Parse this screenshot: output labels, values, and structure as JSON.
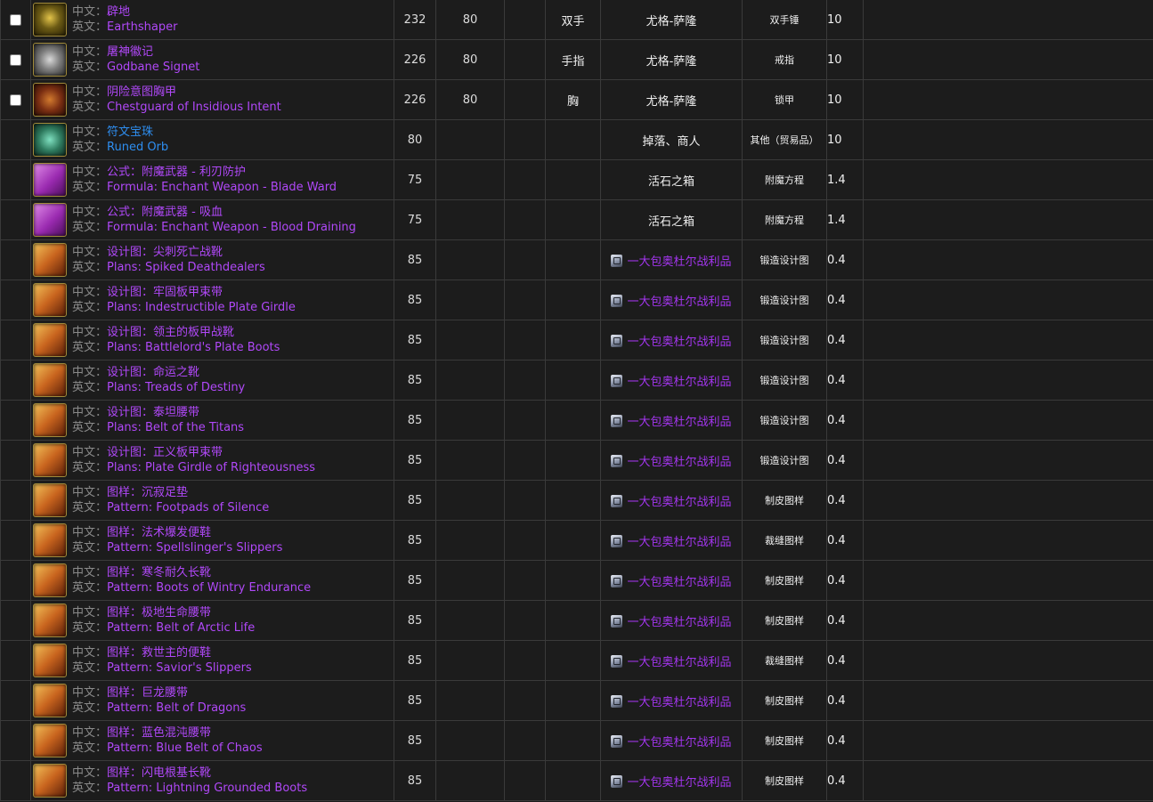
{
  "labels": {
    "cn": "中文：",
    "en": "英文："
  },
  "rows": [
    {
      "checkbox": true,
      "icon": "earthshaper-mace-icon",
      "icon_class": "icon-earthshaper",
      "cn": "辟地",
      "en": "Earthshaper",
      "color": "purple",
      "ilvl": "232",
      "req": "80",
      "slot": "双手",
      "source": "尤格-萨隆",
      "source_link": false,
      "category": "双手锤",
      "drop": "10"
    },
    {
      "checkbox": true,
      "icon": "ring-icon",
      "icon_class": "icon-ring",
      "cn": "屠神徽记",
      "en": "Godbane Signet",
      "color": "purple",
      "ilvl": "226",
      "req": "80",
      "slot": "手指",
      "source": "尤格-萨隆",
      "source_link": false,
      "category": "戒指",
      "drop": "10"
    },
    {
      "checkbox": true,
      "icon": "chestguard-icon",
      "icon_class": "icon-chest",
      "cn": "阴险意图胸甲",
      "en": "Chestguard of Insidious Intent",
      "color": "purple",
      "ilvl": "226",
      "req": "80",
      "slot": "胸",
      "source": "尤格-萨隆",
      "source_link": false,
      "category": "锁甲",
      "drop": "10"
    },
    {
      "checkbox": false,
      "icon": "runed-orb-icon",
      "icon_class": "icon-orb",
      "cn": "符文宝珠",
      "en": "Runed Orb",
      "color": "blue",
      "ilvl": "80",
      "req": "",
      "slot": "",
      "source": "掉落、商人",
      "source_link": false,
      "category": "其他（贸易品）",
      "drop": "10"
    },
    {
      "checkbox": false,
      "icon": "formula-icon",
      "icon_class": "icon-formula",
      "cn": "公式：附魔武器 - 利刃防护",
      "en": "Formula: Enchant Weapon - Blade Ward",
      "color": "purple",
      "ilvl": "75",
      "req": "",
      "slot": "",
      "source": "活石之箱",
      "source_link": false,
      "category": "附魔方程",
      "drop": "1.4"
    },
    {
      "checkbox": false,
      "icon": "formula-icon",
      "icon_class": "icon-formula",
      "cn": "公式：附魔武器 - 吸血",
      "en": "Formula: Enchant Weapon - Blood Draining",
      "color": "purple",
      "ilvl": "75",
      "req": "",
      "slot": "",
      "source": "活石之箱",
      "source_link": false,
      "category": "附魔方程",
      "drop": "1.4"
    },
    {
      "checkbox": false,
      "icon": "plans-icon",
      "icon_class": "icon-plans",
      "cn": "设计图：尖刺死亡战靴",
      "en": "Plans: Spiked Deathdealers",
      "color": "purple",
      "ilvl": "85",
      "req": "",
      "slot": "",
      "source": "一大包奥杜尔战利品",
      "source_link": true,
      "category": "锻造设计图",
      "drop": "0.4"
    },
    {
      "checkbox": false,
      "icon": "plans-icon",
      "icon_class": "icon-plans",
      "cn": "设计图：牢固板甲束带",
      "en": "Plans: Indestructible Plate Girdle",
      "color": "purple",
      "ilvl": "85",
      "req": "",
      "slot": "",
      "source": "一大包奥杜尔战利品",
      "source_link": true,
      "category": "锻造设计图",
      "drop": "0.4"
    },
    {
      "checkbox": false,
      "icon": "plans-icon",
      "icon_class": "icon-plans",
      "cn": "设计图：领主的板甲战靴",
      "en": "Plans: Battlelord's Plate Boots",
      "color": "purple",
      "ilvl": "85",
      "req": "",
      "slot": "",
      "source": "一大包奥杜尔战利品",
      "source_link": true,
      "category": "锻造设计图",
      "drop": "0.4"
    },
    {
      "checkbox": false,
      "icon": "plans-icon",
      "icon_class": "icon-plans",
      "cn": "设计图：命运之靴",
      "en": "Plans: Treads of Destiny",
      "color": "purple",
      "ilvl": "85",
      "req": "",
      "slot": "",
      "source": "一大包奥杜尔战利品",
      "source_link": true,
      "category": "锻造设计图",
      "drop": "0.4"
    },
    {
      "checkbox": false,
      "icon": "plans-icon",
      "icon_class": "icon-plans",
      "cn": "设计图：泰坦腰带",
      "en": "Plans: Belt of the Titans",
      "color": "purple",
      "ilvl": "85",
      "req": "",
      "slot": "",
      "source": "一大包奥杜尔战利品",
      "source_link": true,
      "category": "锻造设计图",
      "drop": "0.4"
    },
    {
      "checkbox": false,
      "icon": "plans-icon",
      "icon_class": "icon-plans",
      "cn": "设计图：正义板甲束带",
      "en": "Plans: Plate Girdle of Righteousness",
      "color": "purple",
      "ilvl": "85",
      "req": "",
      "slot": "",
      "source": "一大包奥杜尔战利品",
      "source_link": true,
      "category": "锻造设计图",
      "drop": "0.4"
    },
    {
      "checkbox": false,
      "icon": "pattern-icon",
      "icon_class": "icon-plans",
      "cn": "图样：沉寂足垫",
      "en": "Pattern: Footpads of Silence",
      "color": "purple",
      "ilvl": "85",
      "req": "",
      "slot": "",
      "source": "一大包奥杜尔战利品",
      "source_link": true,
      "category": "制皮图样",
      "drop": "0.4"
    },
    {
      "checkbox": false,
      "icon": "pattern-icon",
      "icon_class": "icon-plans",
      "cn": "图样：法术爆发便鞋",
      "en": "Pattern: Spellslinger's Slippers",
      "color": "purple",
      "ilvl": "85",
      "req": "",
      "slot": "",
      "source": "一大包奥杜尔战利品",
      "source_link": true,
      "category": "裁缝图样",
      "drop": "0.4"
    },
    {
      "checkbox": false,
      "icon": "pattern-icon",
      "icon_class": "icon-plans",
      "cn": "图样：寒冬耐久长靴",
      "en": "Pattern: Boots of Wintry Endurance",
      "color": "purple",
      "ilvl": "85",
      "req": "",
      "slot": "",
      "source": "一大包奥杜尔战利品",
      "source_link": true,
      "category": "制皮图样",
      "drop": "0.4"
    },
    {
      "checkbox": false,
      "icon": "pattern-icon",
      "icon_class": "icon-plans",
      "cn": "图样：极地生命腰带",
      "en": "Pattern: Belt of Arctic Life",
      "color": "purple",
      "ilvl": "85",
      "req": "",
      "slot": "",
      "source": "一大包奥杜尔战利品",
      "source_link": true,
      "category": "制皮图样",
      "drop": "0.4"
    },
    {
      "checkbox": false,
      "icon": "pattern-icon",
      "icon_class": "icon-plans",
      "cn": "图样：救世主的便鞋",
      "en": "Pattern: Savior's Slippers",
      "color": "purple",
      "ilvl": "85",
      "req": "",
      "slot": "",
      "source": "一大包奥杜尔战利品",
      "source_link": true,
      "category": "裁缝图样",
      "drop": "0.4"
    },
    {
      "checkbox": false,
      "icon": "pattern-icon",
      "icon_class": "icon-plans",
      "cn": "图样：巨龙腰带",
      "en": "Pattern: Belt of Dragons",
      "color": "purple",
      "ilvl": "85",
      "req": "",
      "slot": "",
      "source": "一大包奥杜尔战利品",
      "source_link": true,
      "category": "制皮图样",
      "drop": "0.4"
    },
    {
      "checkbox": false,
      "icon": "pattern-icon",
      "icon_class": "icon-plans",
      "cn": "图样：蓝色混沌腰带",
      "en": "Pattern: Blue Belt of Chaos",
      "color": "purple",
      "ilvl": "85",
      "req": "",
      "slot": "",
      "source": "一大包奥杜尔战利品",
      "source_link": true,
      "category": "制皮图样",
      "drop": "0.4"
    },
    {
      "checkbox": false,
      "icon": "pattern-icon",
      "icon_class": "icon-plans",
      "cn": "图样：闪电根基长靴",
      "en": "Pattern: Lightning Grounded Boots",
      "color": "purple",
      "ilvl": "85",
      "req": "",
      "slot": "",
      "source": "一大包奥杜尔战利品",
      "source_link": true,
      "category": "制皮图样",
      "drop": "0.4"
    }
  ],
  "colors": {
    "purple": "#b048f8",
    "blue": "#2e8ef0",
    "source_link": "#a335ee",
    "background": "#1c1c1c",
    "border": "#3a3a3a"
  }
}
